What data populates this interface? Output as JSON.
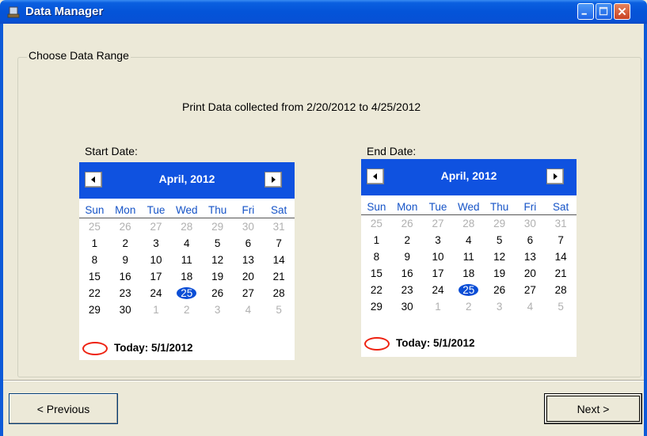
{
  "window": {
    "title": "Data Manager",
    "controls": [
      "minimize-icon",
      "maximize-icon",
      "close-icon"
    ]
  },
  "group": {
    "label": "Choose Data Range",
    "summary": "Print Data collected from 2/20/2012 to 4/25/2012"
  },
  "start": {
    "label": "Start Date:",
    "month": "April, 2012",
    "dow": [
      "Sun",
      "Mon",
      "Tue",
      "Wed",
      "Thu",
      "Fri",
      "Sat"
    ],
    "weeks": [
      [
        "25",
        "26",
        "27",
        "28",
        "29",
        "30",
        "31"
      ],
      [
        "1",
        "2",
        "3",
        "4",
        "5",
        "6",
        "7"
      ],
      [
        "8",
        "9",
        "10",
        "11",
        "12",
        "13",
        "14"
      ],
      [
        "15",
        "16",
        "17",
        "18",
        "19",
        "20",
        "21"
      ],
      [
        "22",
        "23",
        "24",
        "25",
        "26",
        "27",
        "28"
      ],
      [
        "29",
        "30",
        "1",
        "2",
        "3",
        "4",
        "5"
      ]
    ],
    "selected_day": "25",
    "today": "Today: 5/1/2012"
  },
  "end": {
    "label": "End Date:",
    "month": "April, 2012",
    "dow": [
      "Sun",
      "Mon",
      "Tue",
      "Wed",
      "Thu",
      "Fri",
      "Sat"
    ],
    "weeks": [
      [
        "25",
        "26",
        "27",
        "28",
        "29",
        "30",
        "31"
      ],
      [
        "1",
        "2",
        "3",
        "4",
        "5",
        "6",
        "7"
      ],
      [
        "8",
        "9",
        "10",
        "11",
        "12",
        "13",
        "14"
      ],
      [
        "15",
        "16",
        "17",
        "18",
        "19",
        "20",
        "21"
      ],
      [
        "22",
        "23",
        "24",
        "25",
        "26",
        "27",
        "28"
      ],
      [
        "29",
        "30",
        "1",
        "2",
        "3",
        "4",
        "5"
      ]
    ],
    "selected_day": "25",
    "today": "Today: 5/1/2012"
  },
  "buttons": {
    "previous": "< Previous",
    "next": "Next >"
  },
  "colors": {
    "titlebar": "#0454d8",
    "calendar_header": "#0f52e0",
    "selected_day": "#0b4ed6",
    "weekday_text": "#1553c7",
    "today_circle": "#e21111"
  }
}
